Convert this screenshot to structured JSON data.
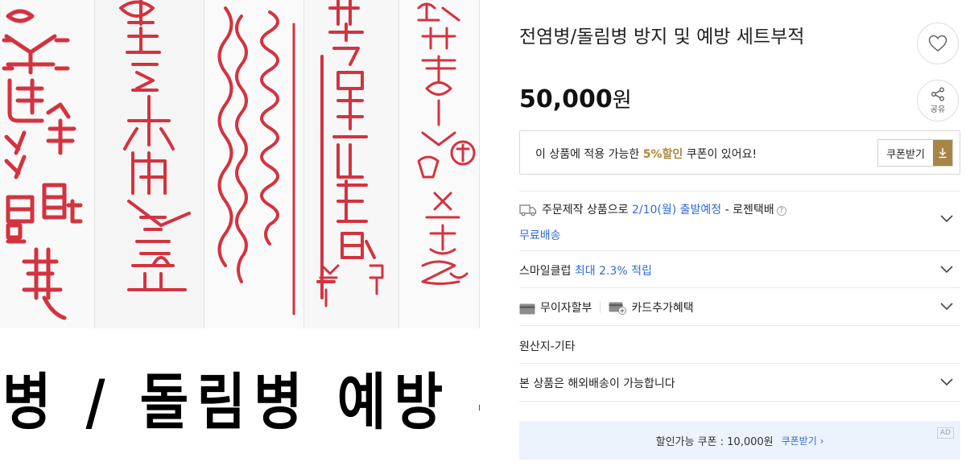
{
  "product": {
    "title": "전염병/돌림병 방지 및 예방 세트부적",
    "price_number": "50,000",
    "price_unit": "원",
    "image_caption": "전염병 / 돌림병 예방 부적"
  },
  "actions": {
    "like_icon": "heart-icon",
    "share_icon": "share-icon",
    "share_label": "공유"
  },
  "coupon": {
    "text_before": "이 상품에 적용 가능한 ",
    "highlight": "5%할인",
    "text_after": " 쿠폰이 있어요!",
    "button_label": "쿠폰받기",
    "button_icon": "download-icon",
    "highlight_color": "#b1873b",
    "button_color": "#a88547"
  },
  "delivery": {
    "icon": "truck-icon",
    "prefix": "주문제작 상품으로 ",
    "date": "2/10(월) 출발예정",
    "carrier": " - 로젠택배",
    "help_icon": "?",
    "free_shipping": "무료배송"
  },
  "smileclub": {
    "label": "스마일클럽 ",
    "benefit": "최대 2.3% 적립"
  },
  "payment": {
    "installment_icon": "card-icon",
    "installment_label": "무이자할부",
    "card_benefit_icon": "card-plus-icon",
    "card_benefit_label": "카드추가혜택"
  },
  "origin": {
    "label": "원산지-기타"
  },
  "overseas": {
    "label": "본 상품은 해외배송이 가능합니다"
  },
  "ad_banner": {
    "text": "할인가능 쿠폰 : 10,000원",
    "link": "쿠폰받기 ›",
    "badge": "AD"
  },
  "colors": {
    "link_blue": "#2f6bd2",
    "talisman_red": "#d3333f",
    "ad_background": "#edf3fc"
  }
}
